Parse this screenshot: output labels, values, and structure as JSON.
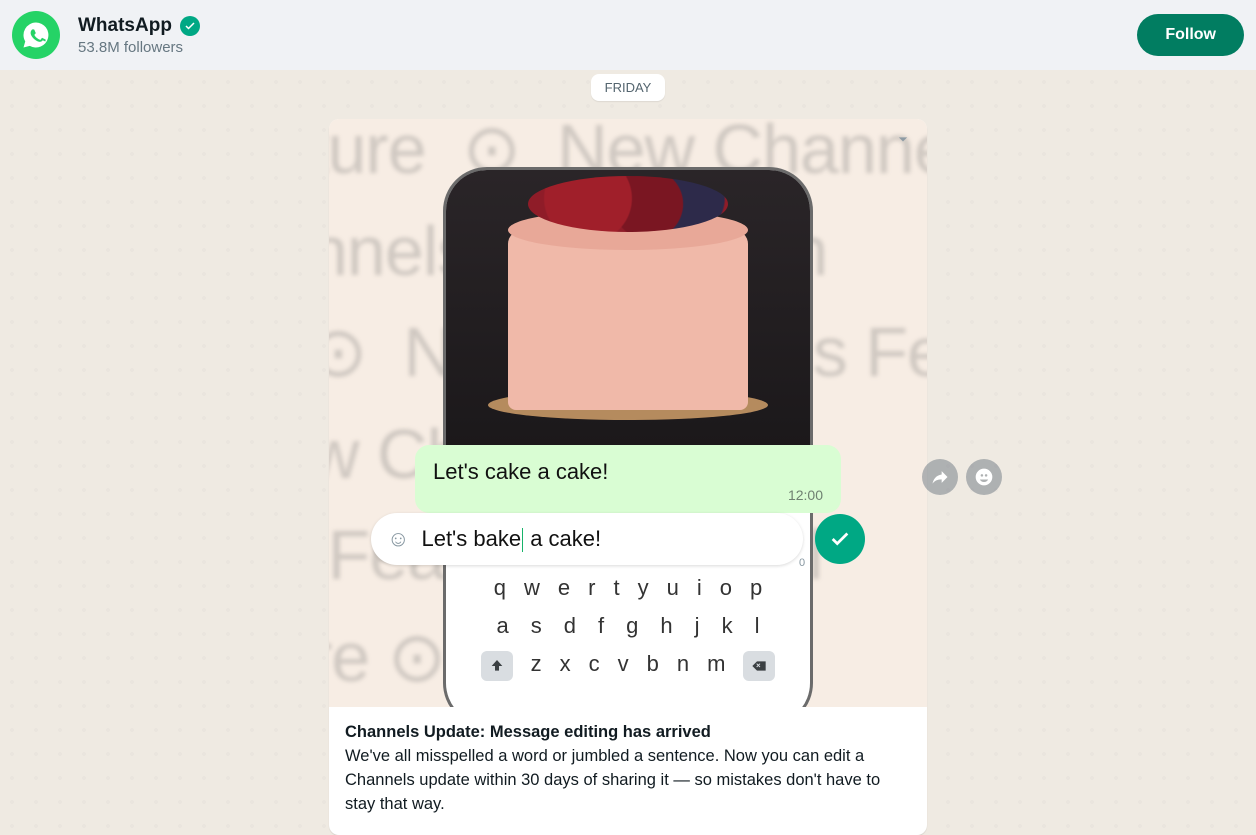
{
  "header": {
    "name": "WhatsApp",
    "followers": "53.8M followers",
    "follow_label": "Follow"
  },
  "date_label": "FRIDAY",
  "illustration": {
    "bg_repeat_text": "New Channels Feature",
    "caption": "Let's cake a cake!",
    "sent_bubble_text": "Let's cake a cake!",
    "sent_bubble_time": "12:00",
    "compose_before": "Let's bake",
    "compose_after": " a cake!",
    "char_count": "0",
    "keyboard": {
      "row1": [
        "q",
        "w",
        "e",
        "r",
        "t",
        "y",
        "u",
        "i",
        "o",
        "p"
      ],
      "row2": [
        "a",
        "s",
        "d",
        "f",
        "g",
        "h",
        "j",
        "k",
        "l"
      ],
      "row3": [
        "z",
        "x",
        "c",
        "v",
        "b",
        "n",
        "m"
      ]
    }
  },
  "post": {
    "headline": "Channels Update: Message editing has arrived",
    "body": "We've all misspelled a word or jumbled a sentence. Now you can edit a Channels update within 30 days of sharing it — so mistakes don't have to stay that way."
  }
}
